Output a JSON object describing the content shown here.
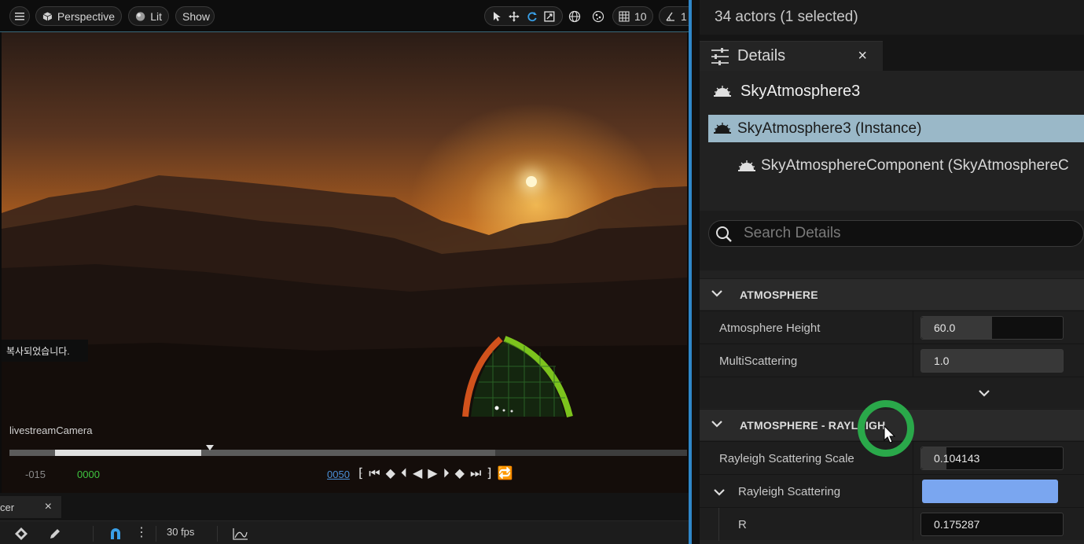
{
  "viewport": {
    "toolbar": {
      "menu_icon": "hamburger-icon",
      "perspective_label": "Perspective",
      "lit_label": "Lit",
      "show_label": "Show",
      "grid_value": "10",
      "angle_value": "1"
    },
    "copied_text": "복사되었습니다.",
    "camera_label": "livestreamCamera",
    "timeline": {
      "start": "-015",
      "current": "0000",
      "end": "0050",
      "current_color": "#3fc33f",
      "end_color": "#4a8fd8",
      "playhead_fraction": 0.29
    }
  },
  "sequencer": {
    "tab_label": "cer",
    "tab_close": "×",
    "fps_label": "30 fps"
  },
  "panel": {
    "actors_summary": "34 actors (1 selected)",
    "details_tab_label": "Details",
    "details_tab_close": "×",
    "actor_name": "SkyAtmosphere3",
    "instance_row": "SkyAtmosphere3 (Instance)",
    "component_row": "SkyAtmosphereComponent (SkyAtmosphereC",
    "search_placeholder": "Search Details",
    "sections": {
      "atmosphere": {
        "title": "ATMOSPHERE",
        "atmosphere_height_label": "Atmosphere Height",
        "atmosphere_height_value": "60.0",
        "multiscattering_label": "MultiScattering",
        "multiscattering_value": "1.0"
      },
      "rayleigh": {
        "title": "ATMOSPHERE - RAYLEIGH",
        "scale_label": "Rayleigh Scattering Scale",
        "scale_value": "0.104143",
        "scattering_label": "Rayleigh Scattering",
        "scattering_color": "#7aa6f0",
        "r_label": "R",
        "r_value": "0.175287"
      }
    }
  },
  "colors": {
    "accent_divider": "#2f87c9",
    "selection_row": "#9ab8c8",
    "cursor_ring": "#2aa84a"
  }
}
